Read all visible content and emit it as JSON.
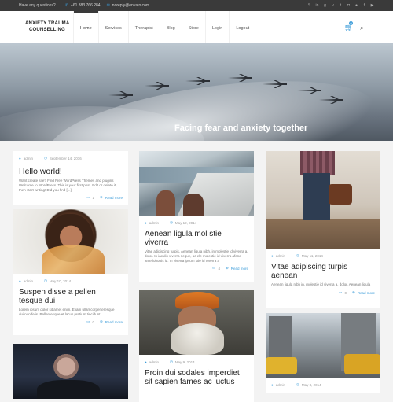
{
  "topbar": {
    "question": "Have any questions?",
    "phone": "+61 383 766 284",
    "email": "noreply@envato.com",
    "social": [
      "skype-icon",
      "linkedin-icon",
      "google-plus-icon",
      "vimeo-icon",
      "twitter-icon",
      "instagram-icon",
      "flickr-icon",
      "facebook-icon",
      "youtube-icon"
    ]
  },
  "header": {
    "logo_line1": "ANXIETY TRAUMA",
    "logo_line2": "COUNSELLING",
    "nav": [
      "Home",
      "Services",
      "Therapist",
      "Blog",
      "Store",
      "Login",
      "Logout"
    ],
    "cart_count": "0"
  },
  "hero": {
    "caption": "Facing fear and anxiety together"
  },
  "posts": {
    "p1": {
      "author": "admin",
      "date": "September 14, 2016",
      "title": "Hello world!",
      "excerpt": "Want create site? Find Free WordPress Themes and plugins Welcome to WordPress. This is your first post. Edit or delete it, then start writing! Did you find [...]",
      "comments": "1",
      "more": "Read more"
    },
    "p2": {
      "author": "admin",
      "date": "May 12, 2014",
      "title": "Aenean ligula mol stie viverra",
      "excerpt": "Vitae adipiscing turpis. Aenean ligula nibh, in molestie id viverra a, dolor. In iaculis viverra neque, ac ele molestie id viverra afend ante lobortis id. In viverra ipsum stie id viverra a",
      "comments": "4",
      "more": "Read more"
    },
    "p3": {
      "author": "admin",
      "date": "May 11, 2014",
      "title": "Vitae adipiscing turpis aenean",
      "excerpt": "Aenean ligula nibh in, molestie id viverra a, dolor. Aenean ligula",
      "comments": "0",
      "more": "Read more"
    },
    "p4": {
      "author": "admin",
      "date": "May 10, 2014",
      "title": "Suspen disse a pellen tesque dui",
      "excerpt": "Lorem ipsum dolor sit amet enim. Etiam ullamcorperteresque dui non felis. Pellentesque et lacus pretium tincidunt.",
      "comments": "0",
      "more": "Read more"
    },
    "p5": {
      "author": "admin",
      "date": "May 9, 2014",
      "title": "Proin dui sodales imperdiet sit sapien fames ac luctus"
    },
    "p6": {
      "author": "admin",
      "date": "May 8, 2014"
    }
  },
  "colors": {
    "accent": "#3b9cd9",
    "topbar": "#3a3a3a"
  }
}
